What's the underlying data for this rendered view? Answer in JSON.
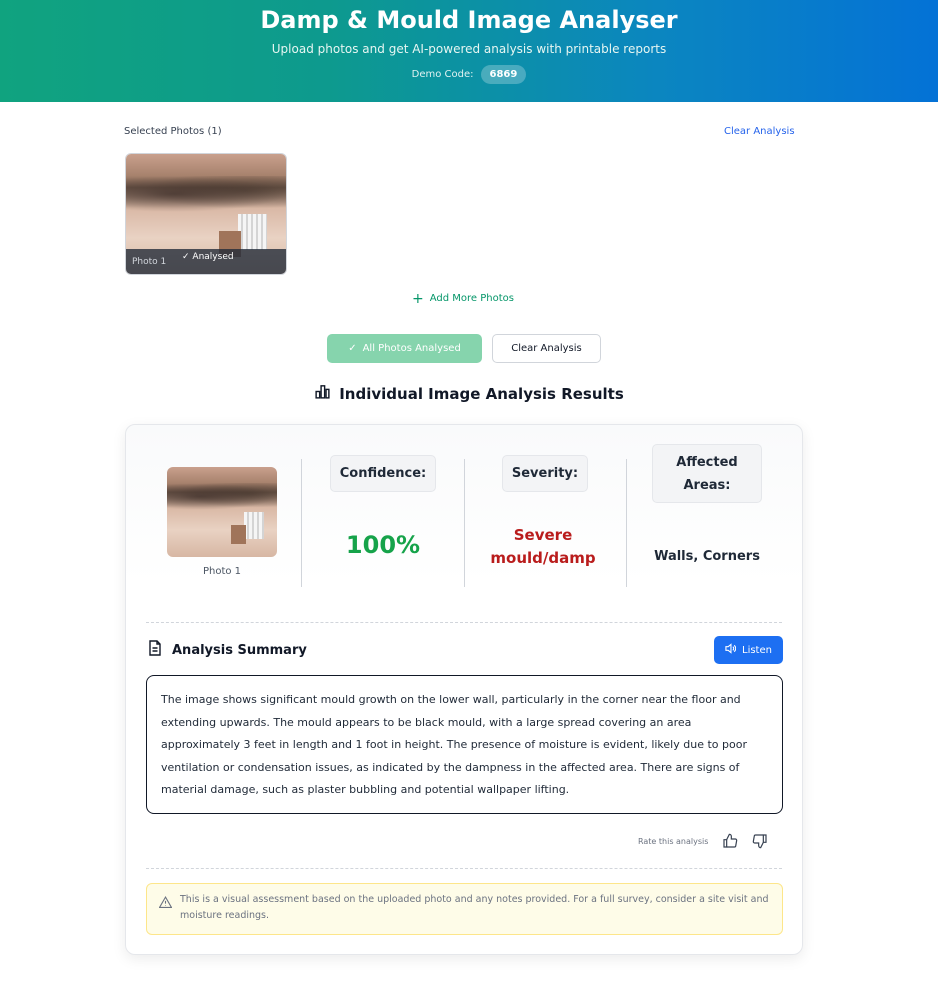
{
  "header": {
    "title": "Damp & Mould Image Analyser",
    "subtitle": "Upload photos and get AI-powered analysis with printable reports",
    "demo_label": "Demo Code:",
    "demo_code": "6869"
  },
  "photos": {
    "selected_label": "Selected Photos (1)",
    "clear_link": "Clear Analysis",
    "items": [
      {
        "caption": "Photo 1",
        "status": "Analysed"
      }
    ],
    "add_more": "Add More Photos"
  },
  "actions": {
    "analysed_button": "All Photos Analysed",
    "clear_button": "Clear Analysis"
  },
  "results": {
    "title": "Individual Image Analysis Results",
    "card": {
      "photo_caption": "Photo 1",
      "confidence_label": "Confidence:",
      "confidence_value": "100%",
      "severity_label": "Severity:",
      "severity_value_line1": "Severe",
      "severity_value_line2": "mould/damp",
      "areas_label_line1": "Affected",
      "areas_label_line2": "Areas:",
      "areas_value": "Walls, Corners",
      "summary_title": "Analysis Summary",
      "listen_button": "Listen",
      "summary_text": "The image shows significant mould growth on the lower wall, particularly in the corner near the floor and extending upwards. The mould appears to be black mould, with a large spread covering an area approximately 3 feet in length and 1 foot in height. The presence of moisture is evident, likely due to poor ventilation or condensation issues, as indicated by the dampness in the affected area. There are signs of material damage, such as plaster bubbling and potential wallpaper lifting.",
      "rate_label": "Rate this analysis",
      "disclaimer": "This is a visual assessment based on the uploaded photo and any notes provided. For a full survey, consider a site visit and moisture readings."
    }
  },
  "colors": {
    "header_gradient_start": "#10a37f",
    "header_gradient_end": "#0472d6",
    "confidence": "#16a34a",
    "severity": "#b91c1c",
    "listen_button": "#1d6ff2"
  },
  "icons": [
    "check-icon",
    "plus-icon",
    "bar-chart-icon",
    "document-icon",
    "speaker-icon",
    "thumbs-up-icon",
    "thumbs-down-icon",
    "warning-triangle-icon"
  ]
}
